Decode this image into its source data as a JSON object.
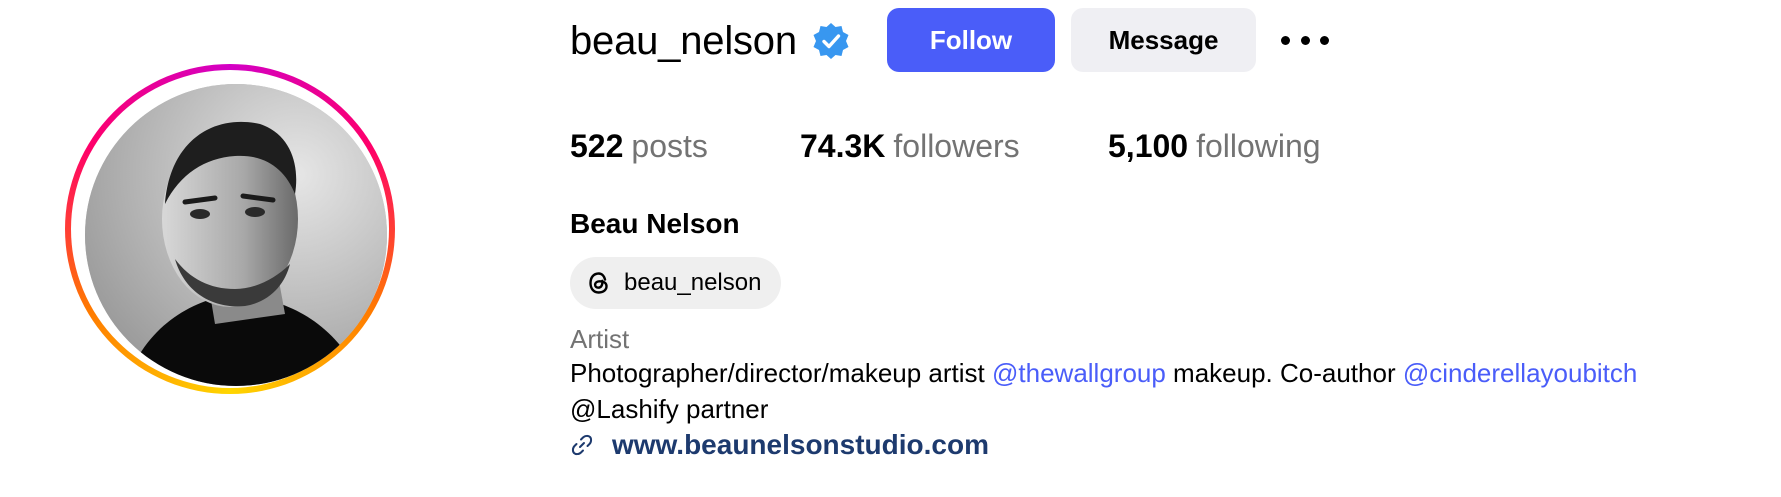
{
  "profile": {
    "username": "beau_nelson",
    "verified_icon": "verified-badge-icon",
    "full_name": "Beau Nelson",
    "category": "Artist",
    "threads_handle": "beau_nelson"
  },
  "actions": {
    "follow_label": "Follow",
    "message_label": "Message",
    "more_icon": "more-options-icon"
  },
  "stats": {
    "posts": {
      "value": "522",
      "label": "posts"
    },
    "followers": {
      "value": "74.3K",
      "label": "followers"
    },
    "following": {
      "value": "5,100",
      "label": "following"
    }
  },
  "bio": {
    "line1_part1": "Photographer/director/makeup artist ",
    "mention1": "@thewallgroup",
    "line1_part2": " makeup. Co-author ",
    "mention2": "@cinderellayoubitch",
    "line2": "@Lashify partner"
  },
  "link": {
    "icon": "link-icon",
    "url": "www.beaunelsonstudio.com"
  },
  "colors": {
    "accent": "#4a5df9",
    "secondary_text": "#737373",
    "link_text": "#1d3a6e",
    "button_secondary_bg": "#efeff3"
  }
}
